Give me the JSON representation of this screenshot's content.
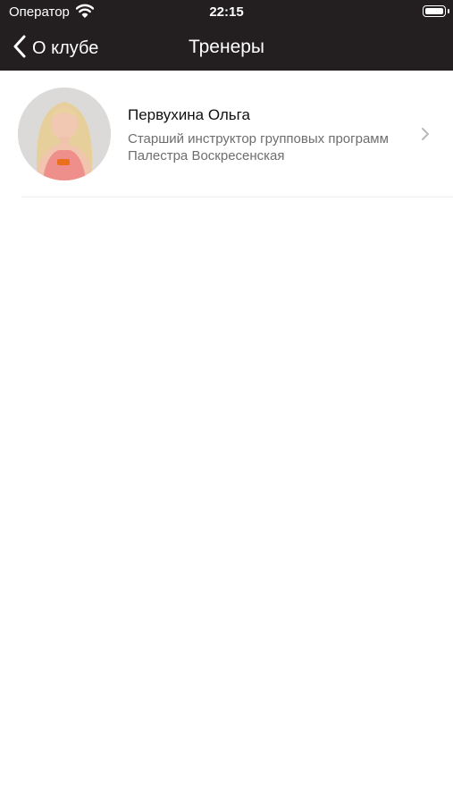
{
  "status_bar": {
    "carrier": "Оператор",
    "time": "22:15"
  },
  "nav": {
    "back_label": "О клубе",
    "title": "Тренеры"
  },
  "trainers": [
    {
      "name": "Первухина Ольга",
      "role": "Старший инструктор групповых программ Палестра Воскресенская"
    }
  ],
  "colors": {
    "bar_background": "#231f20",
    "secondary_text": "#6e6e6e"
  }
}
